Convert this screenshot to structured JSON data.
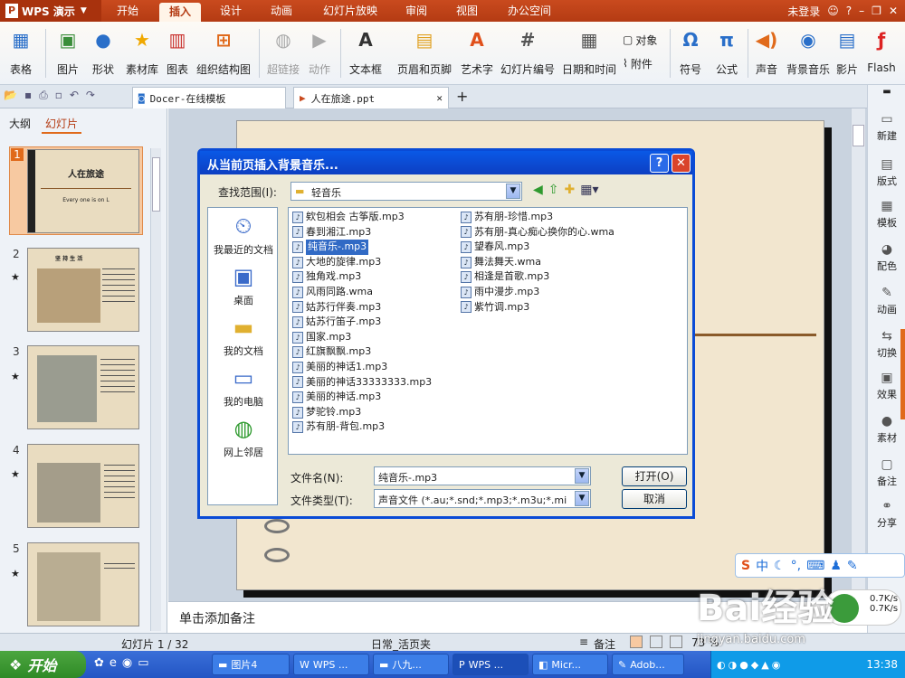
{
  "titlebar": {
    "app": "WPS 演示",
    "tabs": [
      "开始",
      "插入",
      "设计",
      "动画",
      "幻灯片放映",
      "审阅",
      "视图",
      "办公空间"
    ],
    "active_tab": "插入",
    "login": "未登录",
    "help": "?"
  },
  "ribbon": {
    "table": "表格",
    "picture": "图片",
    "shape": "形状",
    "material": "素材库",
    "chart": "图表",
    "org": "组织结构图",
    "hyperlink": "超链接",
    "action": "动作",
    "textbox": "文本框",
    "header_footer": "页眉和页脚",
    "wordart": "艺术字",
    "slide_number": "幻灯片编号",
    "datetime": "日期和时间",
    "object": "对象",
    "attachment": "附件",
    "symbol": "符号",
    "formula": "公式",
    "sound": "声音",
    "bg_music": "背景音乐",
    "movie": "影片",
    "flash": "Flash"
  },
  "doctabs": {
    "tab1": "Docer-在线模板",
    "tab2": "人在旅途.ppt",
    "add": "+"
  },
  "leftpanel": {
    "outline_tab": "大纲",
    "slides_tab": "幻灯片",
    "slide_nums": [
      "1",
      "2",
      "3",
      "4",
      "5"
    ],
    "slide1_title": "人在旅途",
    "slide1_sub": "Every one is on L",
    "slide2_title": "坚 持 生 活"
  },
  "notes": "单击添加备注",
  "rightbar": [
    "新建",
    "版式",
    "模板",
    "配色",
    "动画",
    "切换",
    "效果",
    "素材",
    "备注",
    "分享"
  ],
  "status": {
    "slide": "幻灯片 1 / 32",
    "theme": "日常_活页夹",
    "notes_label": "备注",
    "zoom": "73 %"
  },
  "dialog": {
    "title": "从当前页插入背景音乐...",
    "lookin_label": "查找范围(I):",
    "lookin_value": "轻音乐",
    "places": [
      "我最近的文档",
      "桌面",
      "我的文档",
      "我的电脑",
      "网上邻居"
    ],
    "files_col1": [
      "欸包相会 古筝版.mp3",
      "春到湘江.mp3",
      "纯音乐-.mp3",
      "大地的旋律.mp3",
      "独角戏.mp3",
      "风雨同路.wma",
      "姑苏行伴奏.mp3",
      "姑苏行笛子.mp3",
      "国家.mp3",
      "红旗飘飘.mp3",
      "美丽的神话1.mp3",
      "美丽的神话33333333.mp3",
      "美丽的神话.mp3",
      "梦驼铃.mp3",
      "苏有朋-背包.mp3"
    ],
    "files_col2": [
      "苏有朋-珍惜.mp3",
      "苏有朋-真心痴心换你的心.wma",
      "望春风.mp3",
      "舞法舞天.wma",
      "相逢是首歌.mp3",
      "雨中漫步.mp3",
      "紫竹调.mp3"
    ],
    "selected_file": "纯音乐-.mp3",
    "filename_label": "文件名(N):",
    "filename_value": "纯音乐-.mp3",
    "filetype_label": "文件类型(T):",
    "filetype_value": "声音文件 (*.au;*.snd;*.mp3;*.m3u;*.mi",
    "open_button": "打开(O)",
    "cancel_button": "取消"
  },
  "taskbar": {
    "start": "开始",
    "tasks": [
      "图片4",
      "WPS ...",
      "八九...",
      "WPS ...",
      "Micr...",
      "Adob..."
    ],
    "clock": "13:38",
    "net_up": "0.7K/s",
    "net_down": "0.7K/s"
  },
  "ime": {
    "label": "中"
  },
  "watermark": {
    "text": "Bai经验",
    "url": "jingyan.baidu.com"
  }
}
